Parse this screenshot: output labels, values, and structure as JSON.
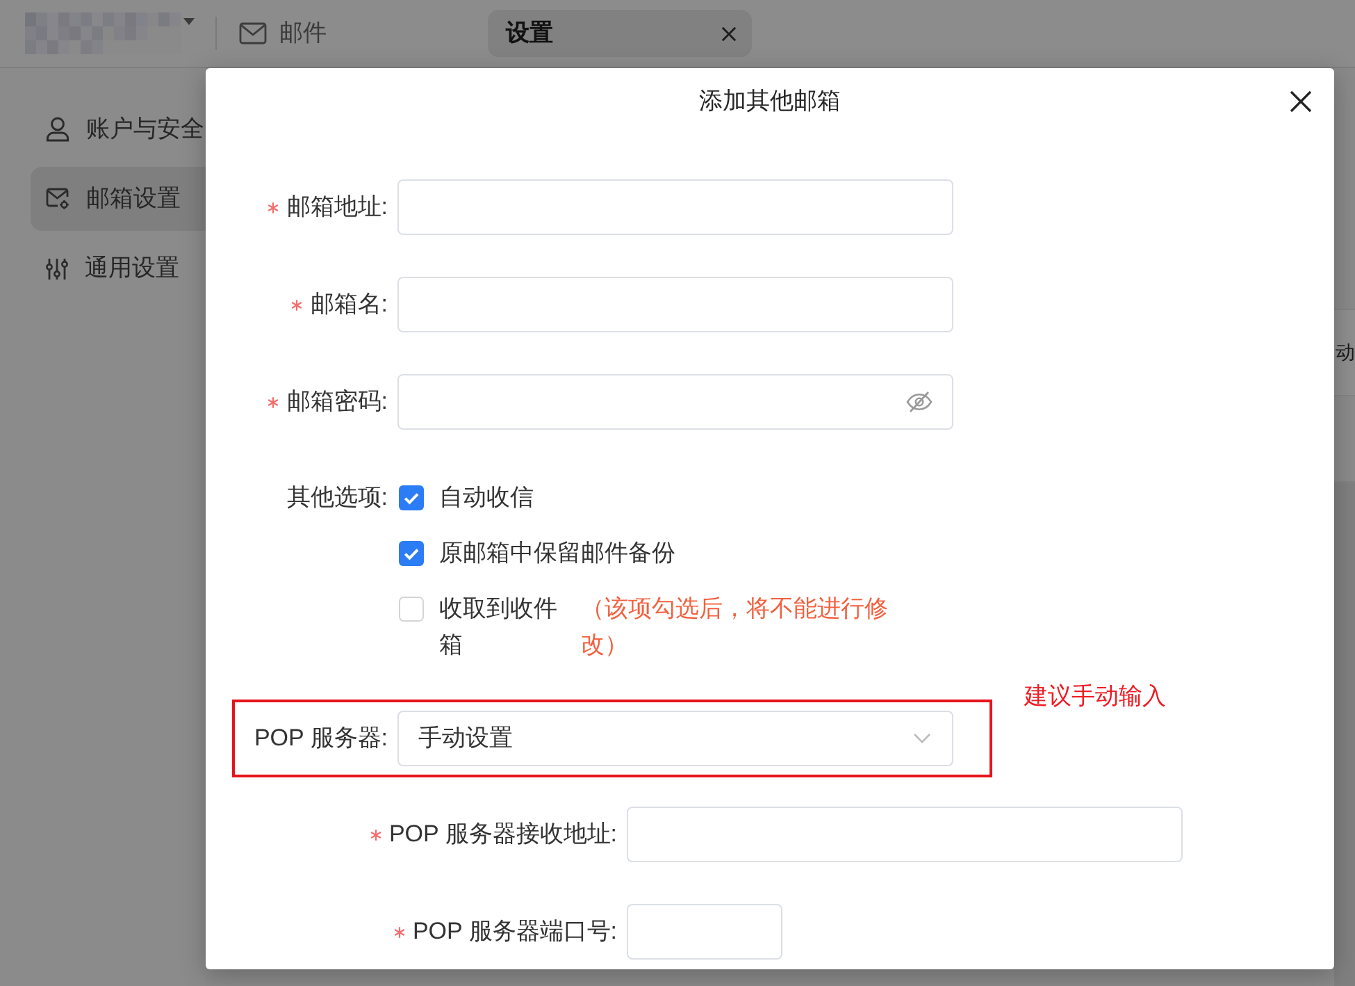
{
  "topbar": {
    "nav_link": {
      "label": "邮件"
    },
    "tabs": [
      {
        "label": "设置",
        "selected": true
      }
    ]
  },
  "sidebar": {
    "items": [
      {
        "label": "账户与安全",
        "selected": false
      },
      {
        "label": "邮箱设置",
        "selected": true
      },
      {
        "label": "通用设置",
        "selected": false
      }
    ]
  },
  "content_behind_dialog": {
    "rows": [
      {
        "text": "动"
      },
      {
        "text": ""
      }
    ]
  },
  "dialog": {
    "title": "添加其他邮箱",
    "sections": [
      {
        "fields": [
          {
            "kind": "text",
            "label": "邮箱地址:",
            "required": true,
            "highlighted": false
          },
          {
            "kind": "text",
            "label": "邮箱名:",
            "required": true,
            "highlighted": false
          },
          {
            "kind": "password",
            "label": "邮箱密码:",
            "required": true,
            "highlighted": false
          }
        ]
      },
      {
        "fields": [
          {
            "kind": "options",
            "label": "其他选项:",
            "required": false,
            "highlighted": false,
            "options": [
              {
                "label": "自动收信",
                "checked": true
              },
              {
                "label": "原邮箱中保留邮件备份",
                "checked": true
              },
              {
                "label": "收取到收件箱",
                "checked": false,
                "note": "（该项勾选后，将不能进行修改）"
              }
            ]
          },
          {
            "kind": "select",
            "label": "POP 服务器:",
            "value": "手动设置",
            "required": false,
            "highlighted": true,
            "annotation": "建议手动输入"
          }
        ]
      },
      {
        "fields": [
          {
            "kind": "text",
            "label": "POP 服务器接收地址:",
            "required": true,
            "highlighted": false
          },
          {
            "kind": "short_text",
            "label": "POP 服务器端口号:",
            "required": true,
            "highlighted": false
          }
        ]
      }
    ]
  }
}
